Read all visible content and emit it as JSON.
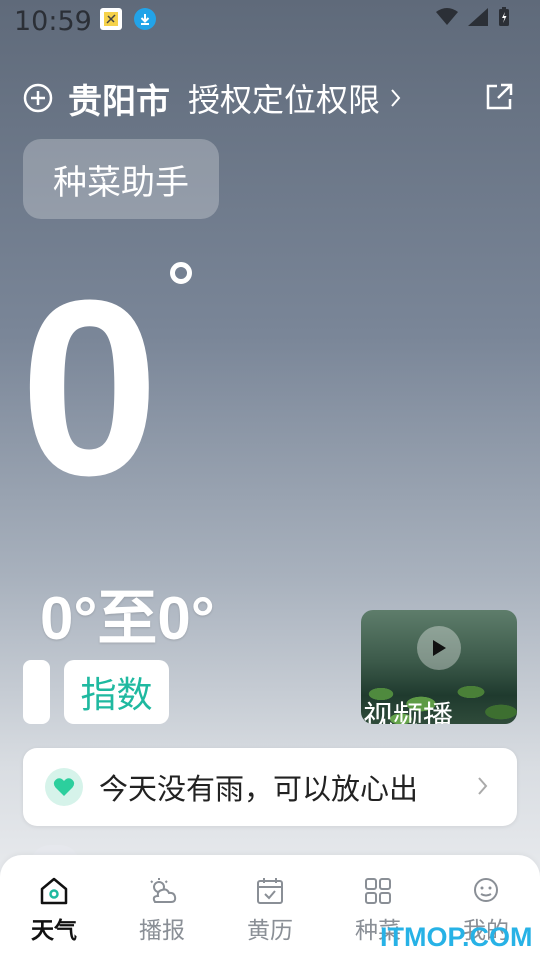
{
  "status_bar": {
    "time": "10:59"
  },
  "header": {
    "city": "贵阳市",
    "permission_label": "授权定位权限"
  },
  "chip": {
    "label": "种菜助手"
  },
  "weather": {
    "temperature": "0",
    "range": "0°至0°",
    "index_label": "指数"
  },
  "video": {
    "label": "视频播"
  },
  "rain_card": {
    "text": "今天没有雨，可以放心出"
  },
  "bottom_nav": {
    "items": [
      {
        "label": "天气",
        "icon": "home-icon",
        "active": true
      },
      {
        "label": "播报",
        "icon": "weather-cloud-icon",
        "active": false
      },
      {
        "label": "黄历",
        "icon": "calendar-icon",
        "active": false
      },
      {
        "label": "种菜",
        "icon": "grid-icon",
        "active": false
      },
      {
        "label": "我的",
        "icon": "profile-icon",
        "active": false
      }
    ]
  },
  "watermark": "ITMOP.COM",
  "colors": {
    "accent": "#1fb9a0",
    "watermark": "#27b2e6"
  }
}
